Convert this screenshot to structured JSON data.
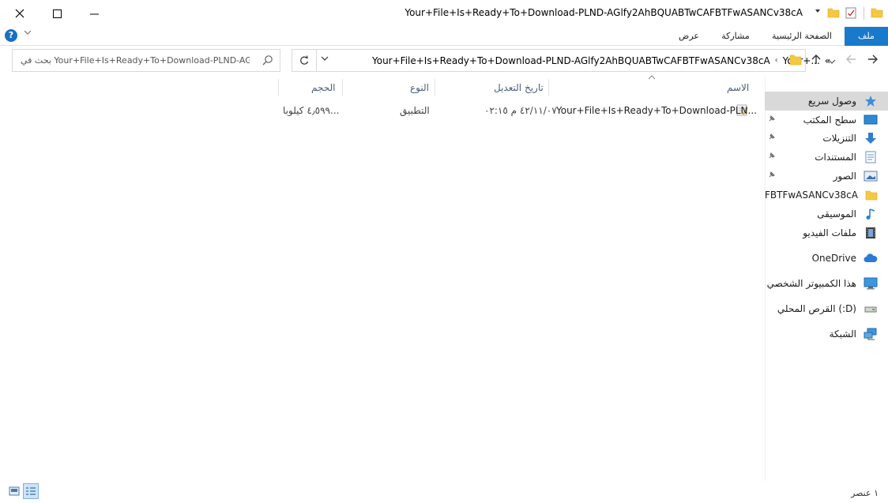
{
  "window": {
    "title": "Your+File+Is+Ready+To+Download-PLND-AGlfy2AhBQUABTwCAFBTFwASANCv38cA"
  },
  "ribbon": {
    "tabs": [
      {
        "label": "ملف",
        "active": true
      },
      {
        "label": "الصفحة الرئيسية"
      },
      {
        "label": "مشاركة"
      },
      {
        "label": "عرض"
      }
    ],
    "help_label": "?"
  },
  "address": {
    "crumbs": [
      "Your+...",
      "Your+File+Is+Ready+To+Download-PLND-AGlfy2AhBQUABTwCAFBTFwASANCv38cA"
    ],
    "overflow": "«"
  },
  "search": {
    "placeholder": "بحث في Your+File+Is+Ready+To+Download-PLND-AGI..."
  },
  "columns": {
    "name": "الاسم",
    "date": "تاريخ التعديل",
    "type": "النوع",
    "size": "الحجم"
  },
  "files": [
    {
      "name": "Your+File+Is+Ready+To+Download-PLN...",
      "date": "٤٢/١١/٠٧ م ٠٢:١٥",
      "type": "التطبيق",
      "size": "٤٫٥٩٩ كيلوبا..."
    }
  ],
  "nav": {
    "items": [
      {
        "label": "وصول سريع",
        "icon": "star-icon",
        "selected": true
      },
      {
        "label": "سطح المكتب",
        "icon": "desktop-icon",
        "pinned": true
      },
      {
        "label": "التنزيلات",
        "icon": "download-icon",
        "pinned": true
      },
      {
        "label": "المستندات",
        "icon": "document-icon",
        "pinned": true
      },
      {
        "label": "الصور",
        "icon": "pictures-icon",
        "pinned": true
      },
      {
        "label": "FBTFwASANCv38cA",
        "icon": "folder-icon"
      },
      {
        "label": "الموسيقى",
        "icon": "music-icon"
      },
      {
        "label": "ملفات الفيديو",
        "icon": "video-icon"
      },
      {
        "label": "OneDrive",
        "icon": "cloud-icon"
      },
      {
        "label": "هذا الكمبيوتر الشخصي",
        "icon": "computer-icon"
      },
      {
        "label": "القرص المحلي (:D)",
        "icon": "drive-icon"
      },
      {
        "label": "الشبكة",
        "icon": "network-icon"
      }
    ]
  },
  "status": {
    "count": "١ عنصر"
  },
  "colors": {
    "accent": "#1979ca",
    "selected_bg": "#d9d9d9",
    "header_text": "#4c607a"
  }
}
